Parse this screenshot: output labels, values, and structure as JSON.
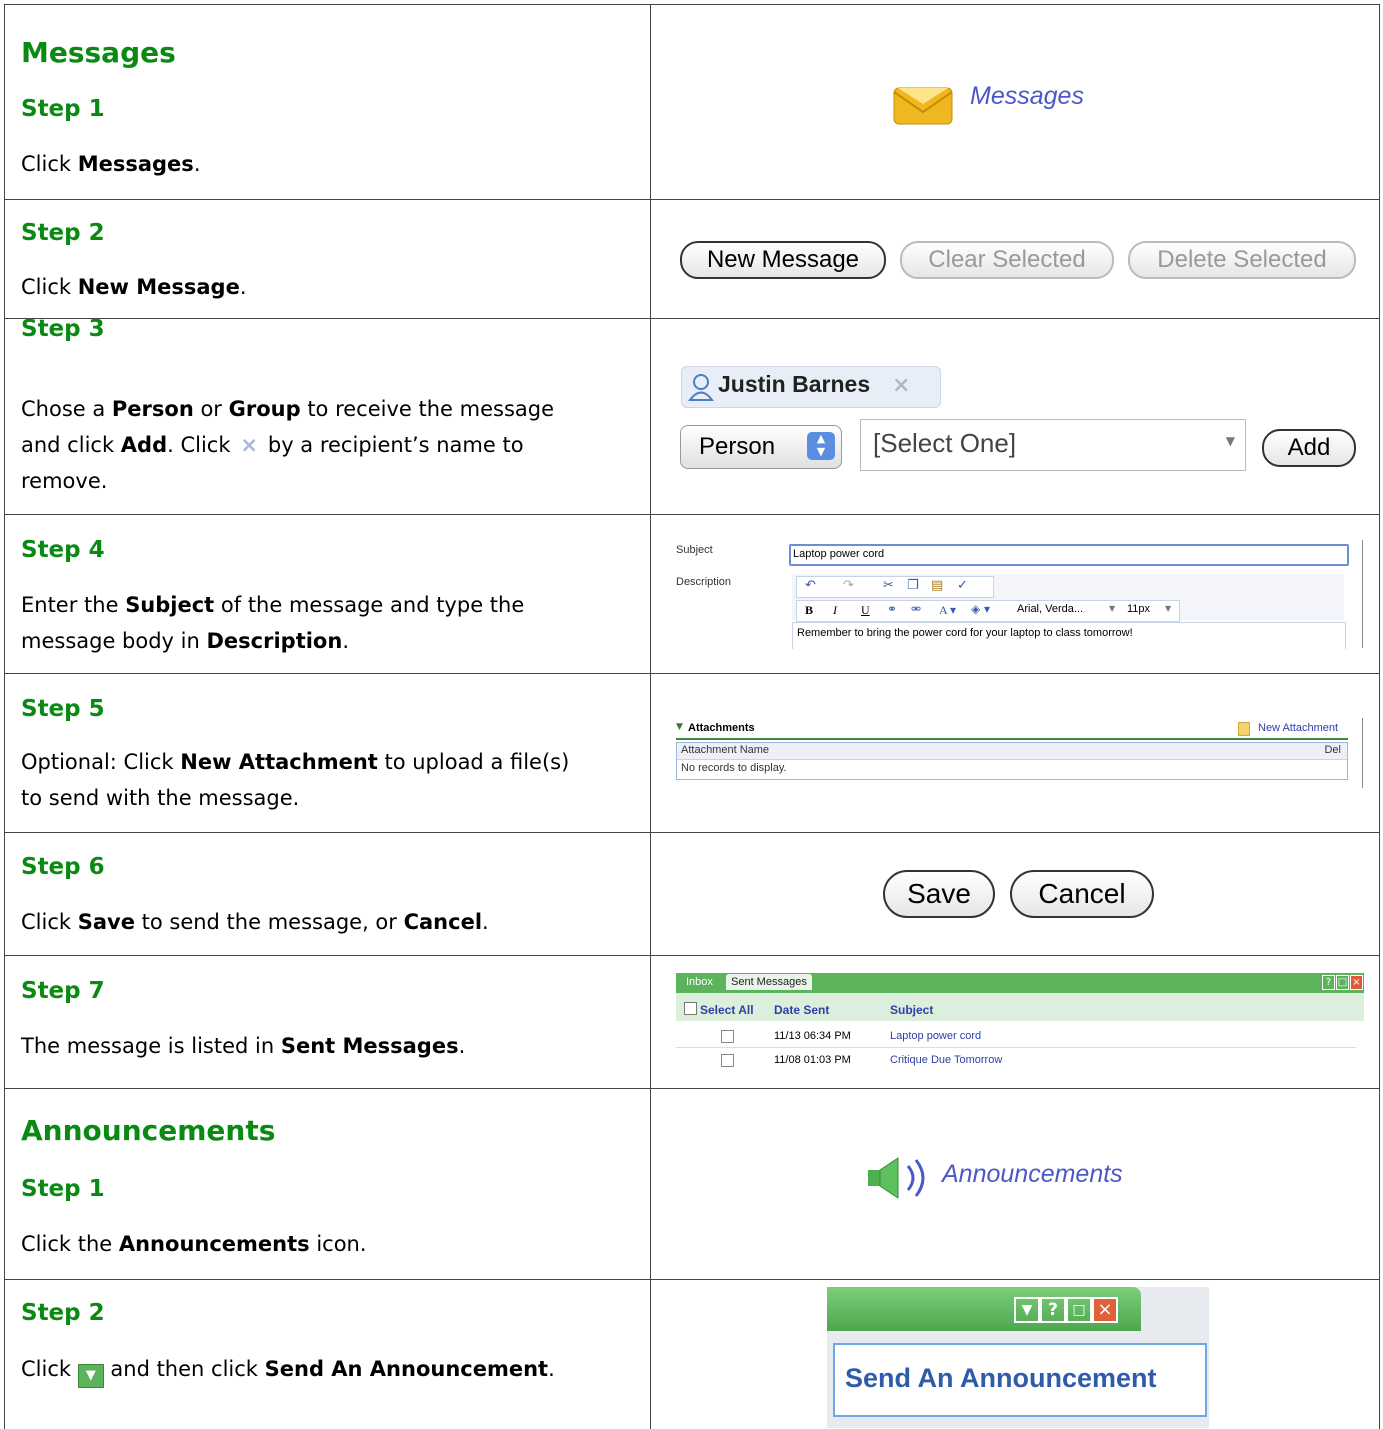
{
  "messages": {
    "heading": "Messages",
    "step1": {
      "label": "Step 1",
      "pre": "Click ",
      "b1": "Messages",
      "post": ".",
      "image_label": "Messages"
    },
    "step2": {
      "label": "Step 2",
      "pre": "Click ",
      "b1": "New Message",
      "post": ".",
      "buttons": [
        "New Message",
        "Clear Selected",
        "Delete Selected"
      ]
    },
    "step3": {
      "label": "Step 3",
      "t1": "Chose a ",
      "b1": "Person",
      "t2": " or ",
      "b2": "Group",
      "t3": " to receive the message",
      "t4": "and click ",
      "b3": "Add",
      "t5": ". Click ",
      "t6": " by a recipient’s name to",
      "t7": "remove.",
      "recipient": "Justin Barnes",
      "type_select": "Person",
      "select_placeholder": "[Select One]",
      "add_button": "Add"
    },
    "step4": {
      "label": "Step 4",
      "t1": "Enter the ",
      "b1": "Subject",
      "t2": " of the message and type the",
      "t3": "message body in ",
      "b2": "Description",
      "t4": ".",
      "subject_label": "Subject",
      "subject_value": "Laptop power cord",
      "description_label": "Description",
      "font_select": "Arial, Verda...",
      "size_select": "11px",
      "body": "Remember to bring the power cord for your laptop to class tomorrow!"
    },
    "step5": {
      "label": "Step 5",
      "t1": "Optional: Click ",
      "b1": "New Attachment",
      "t2": " to upload a file(s)",
      "t3": "to send with the message.",
      "panel_title": "Attachments",
      "new_attachment": "New Attachment",
      "col_name": "Attachment Name",
      "col_del": "Del",
      "empty": "No records to display."
    },
    "step6": {
      "label": "Step 6",
      "t1": "Click ",
      "b1": "Save",
      "t2": " to send the message, or ",
      "b2": "Cancel",
      "t3": ".",
      "save": "Save",
      "cancel": "Cancel"
    },
    "step7": {
      "label": "Step 7",
      "t1": "The message is listed in ",
      "b1": "Sent Messages",
      "t2": ".",
      "tab_inbox": "Inbox",
      "tab_sent": "Sent Messages",
      "col_select": "Select All",
      "col_date": "Date Sent",
      "col_subject": "Subject",
      "rows": [
        {
          "date": "11/13 06:34 PM",
          "subject": "Laptop power cord"
        },
        {
          "date": "11/08 01:03 PM",
          "subject": "Critique Due Tomorrow"
        }
      ]
    }
  },
  "announcements": {
    "heading": "Announcements",
    "step1": {
      "label": "Step 1",
      "t1": "Click the ",
      "b1": "Announcements",
      "t2": " icon.",
      "image_label": "Announcements"
    },
    "step2": {
      "label": "Step 2",
      "t1": "Click ",
      "t2": " and then click ",
      "b1": "Send An Announcement",
      "t3": ".",
      "menu_item": "Send An Announcement"
    }
  },
  "colors": {
    "heading": "#0a8a12",
    "link": "#2e3fa8",
    "panel_green": "#6cc36c"
  }
}
